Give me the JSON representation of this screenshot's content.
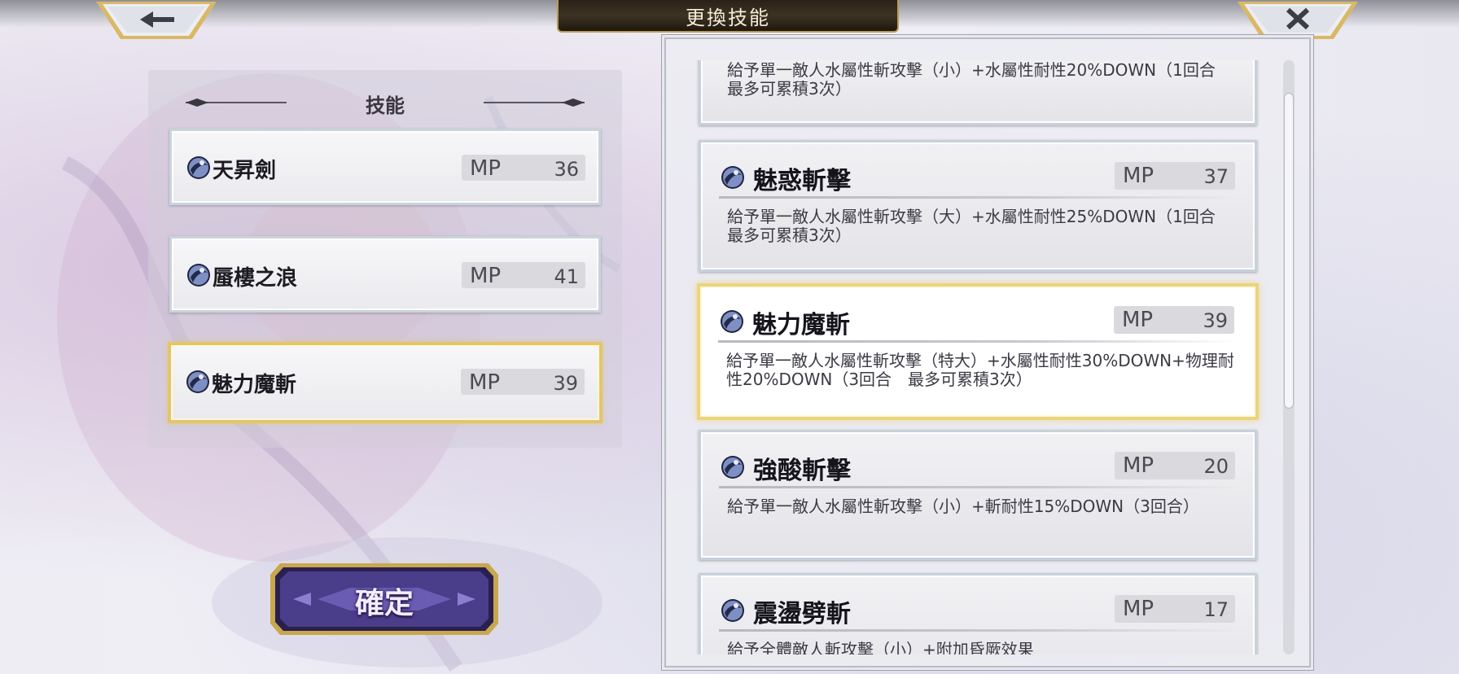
{
  "header": {
    "title": "更換技能",
    "back_icon": "arrow-left-icon",
    "close_icon": "close-x-icon"
  },
  "equipped": {
    "title": "技能",
    "slots": [
      {
        "name": "天昇劍",
        "mp_label": "MP",
        "mp": "36",
        "selected": false
      },
      {
        "name": "蜃樓之浪",
        "mp_label": "MP",
        "mp": "41",
        "selected": false
      },
      {
        "name": "魅力魔斬",
        "mp_label": "MP",
        "mp": "39",
        "selected": true
      }
    ]
  },
  "confirm": {
    "label": "確定"
  },
  "skills": {
    "items": [
      {
        "name": "",
        "mp_label": "",
        "mp": "",
        "desc": "給予單一敵人水屬性斬攻擊（小）+水屬性耐性20%DOWN（1回合　最多可累積3次）",
        "selected": false
      },
      {
        "name": "魅惑斬擊",
        "mp_label": "MP",
        "mp": "37",
        "desc": "給予單一敵人水屬性斬攻擊（大）+水屬性耐性25%DOWN（1回合　最多可累積3次）",
        "selected": false
      },
      {
        "name": "魅力魔斬",
        "mp_label": "MP",
        "mp": "39",
        "desc": "給予單一敵人水屬性斬攻擊（特大）+水屬性耐性30%DOWN+物理耐性20%DOWN（3回合　最多可累積3次）",
        "selected": true
      },
      {
        "name": "強酸斬擊",
        "mp_label": "MP",
        "mp": "20",
        "desc": "給予單一敵人水屬性斬攻擊（小）+斬耐性15%DOWN（3回合）",
        "selected": false
      },
      {
        "name": "震盪劈斬",
        "mp_label": "MP",
        "mp": "17",
        "desc": "給予全體敵人斬攻擊（小）+附加昏厥效果",
        "selected": false
      }
    ]
  },
  "colors": {
    "selected_border": "#e3c56a",
    "card_border": "#c6d2da",
    "banner_bg": "#2a2118",
    "confirm_bg": "#4a3d8a"
  },
  "skill_icon": "water-orb-icon"
}
